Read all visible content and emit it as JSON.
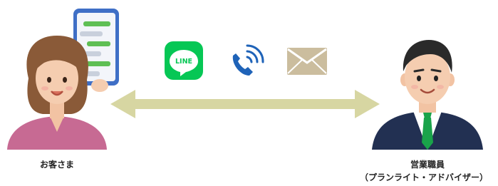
{
  "customer": {
    "label": "お客さま"
  },
  "staff": {
    "label_line1": "営業職員",
    "label_line2": "（プランライト・アドバイザー）"
  },
  "channels": [
    {
      "name": "line",
      "text": "LINE",
      "color": "#06c755"
    },
    {
      "name": "phone",
      "color": "#1f63b8"
    },
    {
      "name": "mail",
      "color": "#cbbd9e"
    }
  ],
  "colors": {
    "arrow": "#d7d6a2",
    "phone_frame": "#3f6fc6",
    "chat_bubble_green": "#5fbf54",
    "customer_shirt": "#c76a93",
    "staff_suit": "#223052",
    "staff_tie": "#1aa34a"
  }
}
